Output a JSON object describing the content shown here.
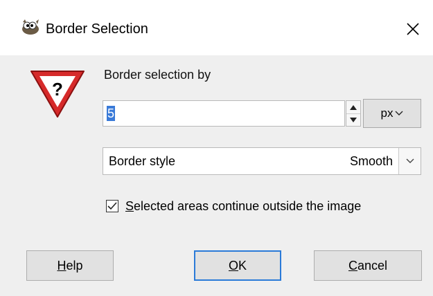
{
  "window": {
    "title": "Border Selection",
    "icon": "gimp-wilber-icon",
    "close": "×"
  },
  "dialog": {
    "icon": "question-warning-icon",
    "label": "Border selection by",
    "spin": {
      "value": "5",
      "up": "▲",
      "down": "▼"
    },
    "unit": {
      "value": "px",
      "chevron": "⌄"
    },
    "style_combo": {
      "label": "Border style",
      "value": "Smooth"
    },
    "checkbox": {
      "checked": true,
      "label_accel": "S",
      "label_rest": "elected areas continue outside the image"
    }
  },
  "buttons": {
    "help": {
      "accel": "H",
      "rest": "elp"
    },
    "ok": {
      "accel": "O",
      "rest": "K"
    },
    "cancel": {
      "accel": "C",
      "rest": "ancel"
    }
  },
  "colors": {
    "selection": "#3a7ad8",
    "default_button_border": "#2a7ad8",
    "warning_red": "#d62a2a"
  }
}
